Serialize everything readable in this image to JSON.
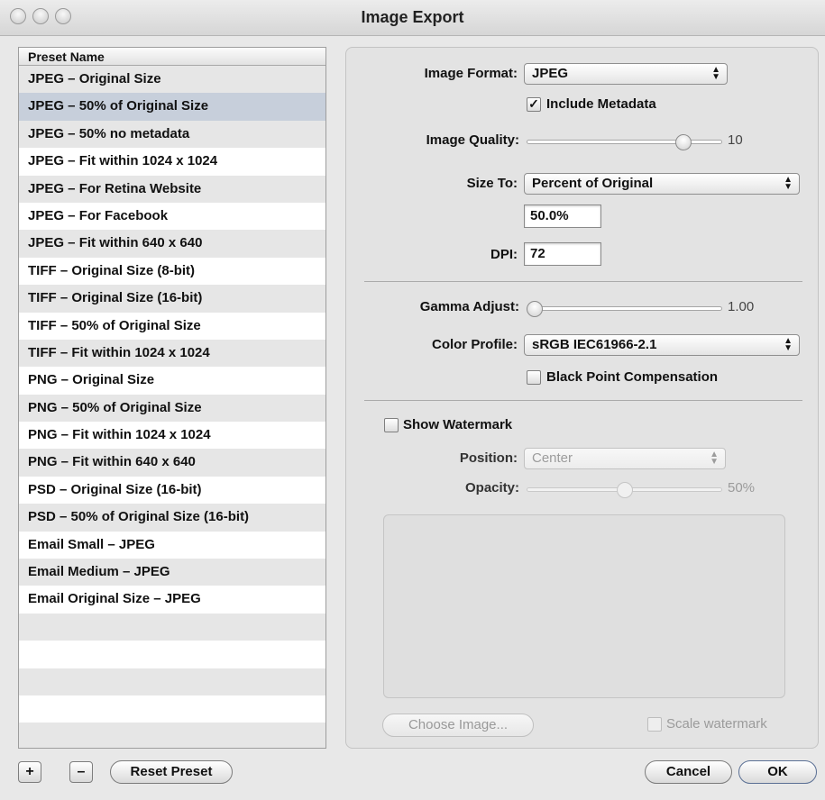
{
  "window": {
    "title": "Image Export"
  },
  "presets": {
    "header": "Preset Name",
    "selected_index": 1,
    "items": [
      "JPEG – Original Size",
      "JPEG – 50% of Original Size",
      "JPEG – 50% no metadata",
      "JPEG – Fit within 1024 x 1024",
      "JPEG – For Retina Website",
      "JPEG – For Facebook",
      "JPEG – Fit within 640 x 640",
      "TIFF – Original Size (8-bit)",
      "TIFF – Original Size (16-bit)",
      "TIFF – 50% of Original Size",
      "TIFF – Fit within 1024 x 1024",
      "PNG – Original Size",
      "PNG – 50% of Original Size",
      "PNG – Fit within 1024 x 1024",
      "PNG – Fit within 640 x 640",
      "PSD – Original Size (16-bit)",
      "PSD – 50% of Original Size (16-bit)",
      "Email Small – JPEG",
      "Email Medium – JPEG",
      "Email Original Size – JPEG"
    ],
    "add_label": "+",
    "remove_label": "–",
    "reset_label": "Reset Preset"
  },
  "settings": {
    "image_format": {
      "label": "Image Format:",
      "value": "JPEG"
    },
    "include_metadata": {
      "label": "Include Metadata",
      "checked": true
    },
    "image_quality": {
      "label": "Image Quality:",
      "value": "10",
      "level": 0.83
    },
    "size_to": {
      "label": "Size To:",
      "value": "Percent of Original",
      "percent": "50.0%"
    },
    "dpi": {
      "label": "DPI:",
      "value": "72"
    },
    "gamma": {
      "label": "Gamma Adjust:",
      "value": "1.00",
      "level": 0.0
    },
    "color_profile": {
      "label": "Color Profile:",
      "value": "sRGB IEC61966-2.1"
    },
    "black_point": {
      "label": "Black Point Compensation",
      "checked": false
    }
  },
  "watermark": {
    "show_label": "Show Watermark",
    "show_checked": false,
    "position_label": "Position:",
    "position_value": "Center",
    "opacity_label": "Opacity:",
    "opacity_value": "50%",
    "opacity_level": 0.5,
    "choose_label": "Choose Image...",
    "scale_label": "Scale watermark",
    "scale_checked": false
  },
  "buttons": {
    "cancel": "Cancel",
    "ok": "OK"
  },
  "icons": {
    "close": "traffic-light-close",
    "minimize": "traffic-light-minimize",
    "zoom": "traffic-light-zoom",
    "checkmark": "✓",
    "popup_arrows": "up-down-arrows"
  }
}
